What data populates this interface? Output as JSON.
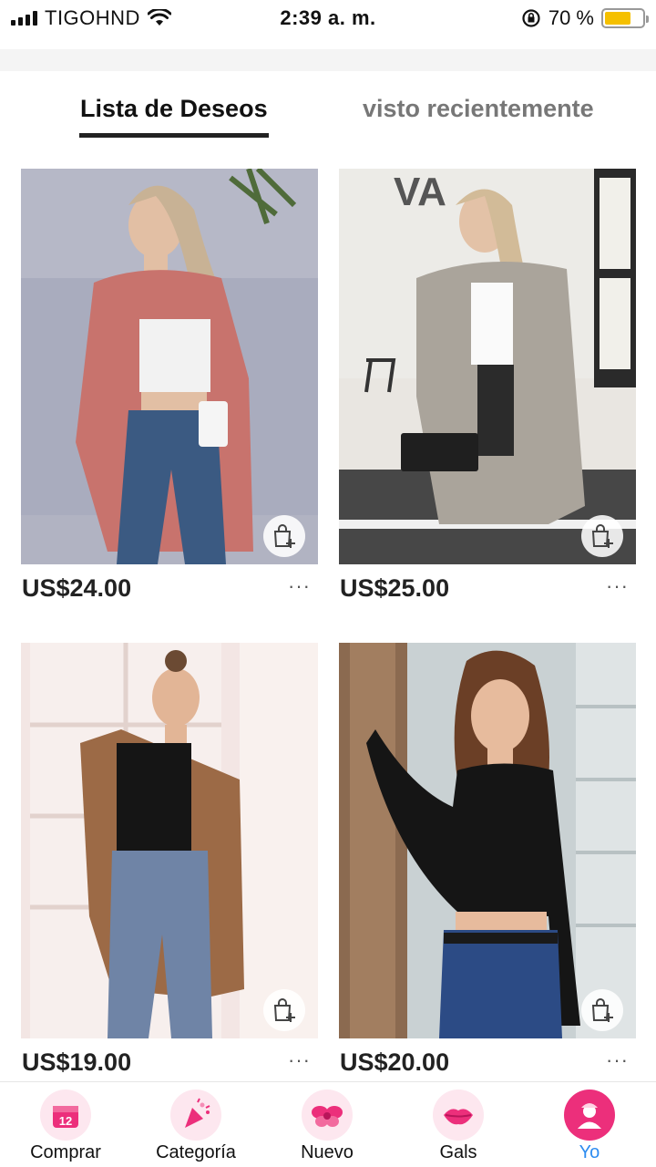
{
  "status_bar": {
    "carrier": "TIGOHND",
    "time": "2:39 a. m.",
    "battery": "70 %",
    "battery_level": 0.7
  },
  "tabs": [
    {
      "label": "Lista de Deseos",
      "active": true
    },
    {
      "label": "visto recientemente",
      "active": false
    }
  ],
  "products": [
    {
      "price": "US$24.00",
      "more": "···",
      "image": "woman-pink-cardigan-photo",
      "icon": "add-to-bag-icon"
    },
    {
      "price": "US$25.00",
      "more": "···",
      "image": "woman-gray-cardigan-photo",
      "icon": "add-to-bag-icon"
    },
    {
      "price": "US$19.00",
      "more": "···",
      "image": "woman-brown-cardigan-photo",
      "icon": "add-to-bag-icon"
    },
    {
      "price": "US$20.00",
      "more": "···",
      "image": "woman-black-cardigan-photo",
      "icon": "add-to-bag-icon"
    }
  ],
  "bottom_nav": [
    {
      "label": "Comprar",
      "icon": "calendar-12-icon",
      "active": false
    },
    {
      "label": "Categoría",
      "icon": "party-popper-icon",
      "active": false
    },
    {
      "label": "Nuevo",
      "icon": "flower-icon",
      "active": false
    },
    {
      "label": "Gals",
      "icon": "lips-icon",
      "active": false
    },
    {
      "label": "Yo",
      "icon": "user-avatar-icon",
      "active": true
    }
  ],
  "colors": {
    "accent_pink": "#ec2f7b",
    "active_label_blue": "#2d8cf0",
    "battery_yellow": "#f5c000"
  }
}
